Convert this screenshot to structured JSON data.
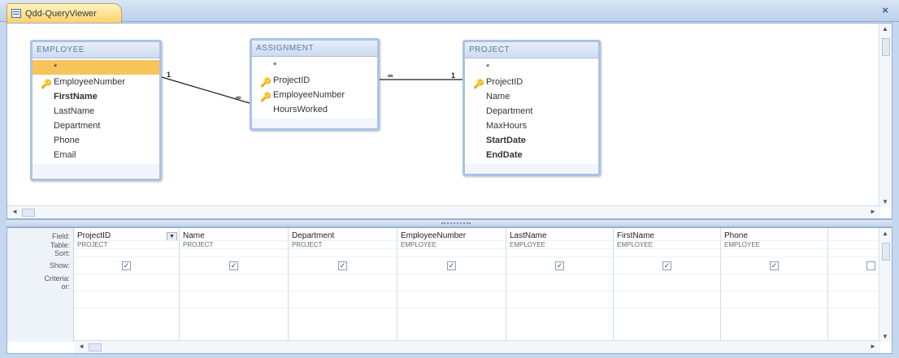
{
  "window": {
    "tab_title": "Qdd-QueryViewer",
    "close_glyph": "×"
  },
  "tables": [
    {
      "title": "EMPLOYEE",
      "fields": [
        {
          "label": "*",
          "key": false,
          "bold": false,
          "selected": true
        },
        {
          "label": "EmployeeNumber",
          "key": true,
          "bold": false,
          "selected": false
        },
        {
          "label": "FirstName",
          "key": false,
          "bold": true,
          "selected": false
        },
        {
          "label": "LastName",
          "key": false,
          "bold": false,
          "selected": false
        },
        {
          "label": "Department",
          "key": false,
          "bold": false,
          "selected": false
        },
        {
          "label": "Phone",
          "key": false,
          "bold": false,
          "selected": false
        },
        {
          "label": "Email",
          "key": false,
          "bold": false,
          "selected": false
        }
      ]
    },
    {
      "title": "ASSIGNMENT",
      "fields": [
        {
          "label": "*",
          "key": false,
          "bold": false,
          "selected": false
        },
        {
          "label": "ProjectID",
          "key": true,
          "bold": false,
          "selected": false
        },
        {
          "label": "EmployeeNumber",
          "key": true,
          "bold": false,
          "selected": false
        },
        {
          "label": "HoursWorked",
          "key": false,
          "bold": false,
          "selected": false
        }
      ]
    },
    {
      "title": "PROJECT",
      "fields": [
        {
          "label": "*",
          "key": false,
          "bold": false,
          "selected": false
        },
        {
          "label": "ProjectID",
          "key": true,
          "bold": false,
          "selected": false
        },
        {
          "label": "Name",
          "key": false,
          "bold": false,
          "selected": false
        },
        {
          "label": "Department",
          "key": false,
          "bold": false,
          "selected": false
        },
        {
          "label": "MaxHours",
          "key": false,
          "bold": false,
          "selected": false
        },
        {
          "label": "StartDate",
          "key": false,
          "bold": true,
          "selected": false
        },
        {
          "label": "EndDate",
          "key": false,
          "bold": true,
          "selected": false
        }
      ]
    }
  ],
  "relationships": {
    "one_label": "1",
    "many_label": "∞"
  },
  "grid": {
    "row_labels": [
      "Field:",
      "Table:",
      "Sort:",
      "Show:",
      "Criteria:",
      "or:"
    ],
    "columns": [
      {
        "field": "ProjectID",
        "table": "PROJECT",
        "show": true
      },
      {
        "field": "Name",
        "table": "PROJECT",
        "show": true
      },
      {
        "field": "Department",
        "table": "PROJECT",
        "show": true
      },
      {
        "field": "EmployeeNumber",
        "table": "EMPLOYEE",
        "show": true
      },
      {
        "field": "LastName",
        "table": "EMPLOYEE",
        "show": true
      },
      {
        "field": "FirstName",
        "table": "EMPLOYEE",
        "show": true
      },
      {
        "field": "Phone",
        "table": "EMPLOYEE",
        "show": true
      },
      {
        "field": "",
        "table": "",
        "show": false
      }
    ],
    "check_glyph": "✓"
  },
  "scroll_glyphs": {
    "up": "▲",
    "down": "▼",
    "left": "◄",
    "right": "►",
    "dropdown": "▼"
  }
}
